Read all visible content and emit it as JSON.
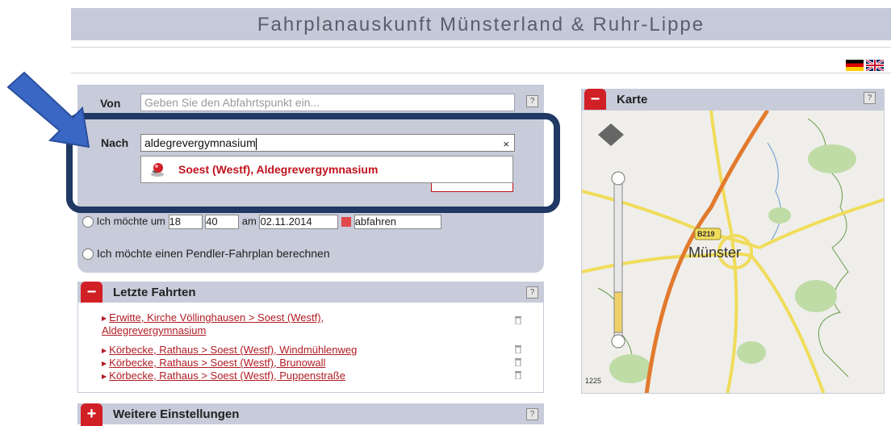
{
  "header": {
    "title": "Fahrplanauskunft  Münsterland & Ruhr-Lippe"
  },
  "languages": [
    "de-flag",
    "gb-flag"
  ],
  "search": {
    "from_label": "Von",
    "from_placeholder": "Geben Sie den Abfahrtspunkt ein...",
    "to_label": "Nach",
    "to_value": "aldegrevergymnasium",
    "clear": "×",
    "help": "?",
    "suggestion": "Soest (Westf), Aldegrevergymnasium",
    "time_prefix": "Ich möchte um",
    "hour": "18",
    "minute": "40",
    "date_prefix": "am",
    "date": "02.11.2014",
    "mode": "abfahren",
    "pendler": "Ich möchte einen Pendler-Fahrplan berechnen"
  },
  "recent": {
    "title": "Letzte Fahrten",
    "icon": "−",
    "items": [
      "Erwitte, Kirche Völlinghausen > Soest (Westf), Aldegrevergymnasium",
      "Körbecke, Rathaus > Soest (Westf), Windmühlenweg",
      "Körbecke, Rathaus > Soest (Westf), Brunowall",
      "Körbecke, Rathaus > Soest (Westf), Puppenstraße"
    ]
  },
  "more": {
    "title": "Weitere Einstellungen",
    "icon": "+"
  },
  "map": {
    "title": "Karte",
    "icon": "−",
    "city": "Münster",
    "road_label": "B219",
    "road_label2": "1225"
  },
  "colors": {
    "accent": "#d11f26",
    "panel": "#c8cbd9",
    "highlight_frame": "#1f3864",
    "arrow": "#3a67c4"
  }
}
